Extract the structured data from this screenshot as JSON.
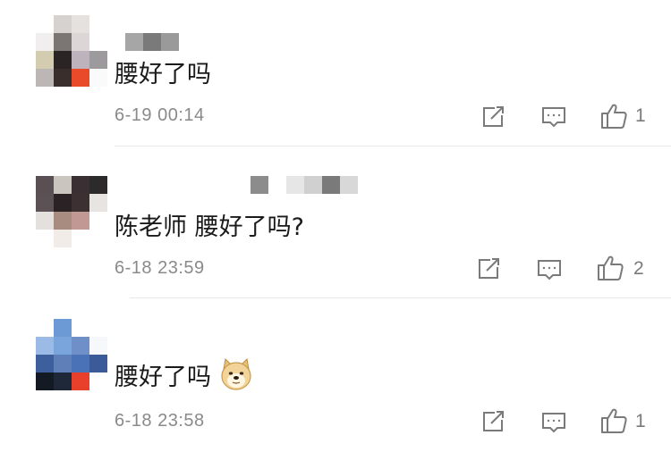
{
  "comments": [
    {
      "text": "腰好了吗",
      "time": "6-19 00:14",
      "likes": "1",
      "emoji": ""
    },
    {
      "text": "陈老师 腰好了吗?",
      "time": "6-18 23:59",
      "likes": "2",
      "emoji": ""
    },
    {
      "text": "腰好了吗",
      "time": "6-18 23:58",
      "likes": "1",
      "emoji": "doge-emoji"
    }
  ],
  "icons": {
    "forward": "share-icon",
    "reply": "comment-icon",
    "like": "thumbs-up-icon"
  },
  "colors": {
    "text": "#1a1a1a",
    "meta": "#8a8a8a",
    "icon": "#7a7a7a",
    "divider": "#e8e8e8"
  }
}
